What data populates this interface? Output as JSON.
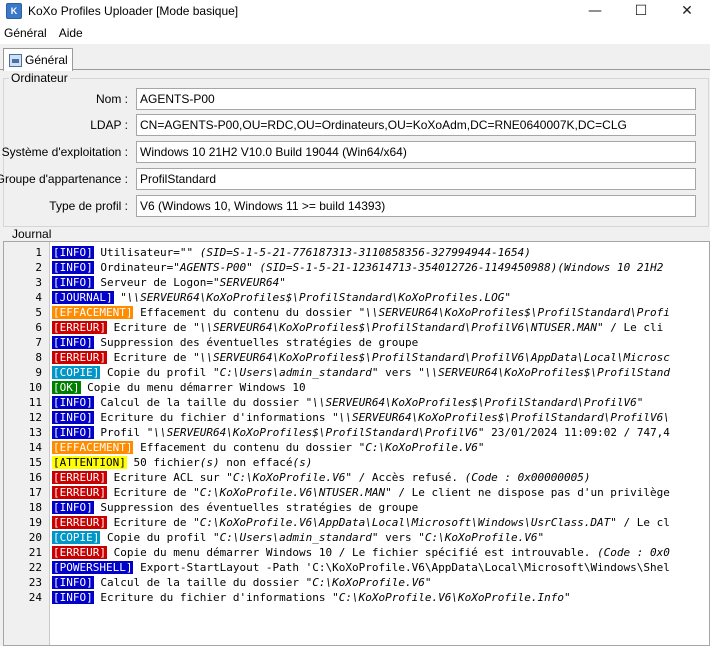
{
  "window": {
    "title": "KoXo Profiles Uploader [Mode basique]",
    "icon": "app-icon",
    "controls": {
      "minimize": "—",
      "maximize": "☐",
      "close": "✕"
    }
  },
  "menu": [
    {
      "label": "Général"
    },
    {
      "label": "Aide"
    }
  ],
  "tabs": [
    {
      "label": "Général",
      "icon": "computer-icon",
      "active": true
    }
  ],
  "ordinateur": {
    "label": "Ordinateur",
    "fields": [
      {
        "name": "nom",
        "label": "Nom :",
        "value": "AGENTS-P00"
      },
      {
        "name": "ldap",
        "label": "LDAP :",
        "value": "CN=AGENTS-P00,OU=RDC,OU=Ordinateurs,OU=KoXoAdm,DC=RNE0640007K,DC=CLG"
      },
      {
        "name": "os",
        "label": "Système d'exploitation :",
        "value": "Windows 10 21H2 V10.0 Build 19044 (Win64/x64)"
      },
      {
        "name": "groupe",
        "label": "Groupe d'appartenance :",
        "value": "ProfilStandard"
      },
      {
        "name": "type-profil",
        "label": "Type de profil :",
        "value": "V6 (Windows 10, Windows 11 >= build 14393)"
      }
    ]
  },
  "journal": {
    "label": "Journal",
    "tag_colors": {
      "INFO": {
        "bg": "#0000c8",
        "fg": "#ffffff"
      },
      "JOURNAL": {
        "bg": "#0000c8",
        "fg": "#ffffff"
      },
      "EFFACEMENT": {
        "bg": "#ff8c00",
        "fg": "#ffffff"
      },
      "ERREUR": {
        "bg": "#c80000",
        "fg": "#ffffff"
      },
      "COPIE": {
        "bg": "#0096c8",
        "fg": "#ffffff"
      },
      "OK": {
        "bg": "#008000",
        "fg": "#ffffff"
      },
      "ATTENTION": {
        "bg": "#ffff00",
        "fg": "#000000"
      },
      "POWERSHELL": {
        "bg": "#0000c8",
        "fg": "#ffffff"
      }
    },
    "lines": [
      {
        "n": "1",
        "tag": "INFO",
        "parts": [
          {
            "t": " Utilisateur="
          },
          {
            "t": "\"\"",
            "s": 1
          },
          {
            "t": "  (SID=S-1-5-21-776187313-3110858356-327994944-1654)",
            "s": 1
          }
        ]
      },
      {
        "n": "2",
        "tag": "INFO",
        "parts": [
          {
            "t": " Ordinateur="
          },
          {
            "t": "\"AGENTS-P00\"",
            "s": 1
          },
          {
            "t": "  (SID=S-1-5-21-123614713-354012726-1149450988)(Windows 10 21H2",
            "s": 1
          }
        ]
      },
      {
        "n": "3",
        "tag": "INFO",
        "parts": [
          {
            "t": " Serveur de Logon="
          },
          {
            "t": "\"SERVEUR64\"",
            "s": 1
          }
        ]
      },
      {
        "n": "4",
        "tag": "JOURNAL",
        "parts": [
          {
            "t": "  "
          },
          {
            "t": "\"\\\\SERVEUR64\\KoXoProfiles$\\ProfilStandard\\KoXoProfiles.LOG\"",
            "s": 1
          }
        ]
      },
      {
        "n": "5",
        "tag": "EFFACEMENT",
        "parts": [
          {
            "t": " Effacement du contenu du dossier "
          },
          {
            "t": "\"\\\\SERVEUR64\\KoXoProfiles$\\ProfilStandard\\Profi",
            "s": 1
          }
        ]
      },
      {
        "n": "6",
        "tag": "ERREUR",
        "parts": [
          {
            "t": " Ecriture de "
          },
          {
            "t": "\"\\\\SERVEUR64\\KoXoProfiles$\\ProfilStandard\\ProfilV6\\NTUSER.MAN\"",
            "s": 1
          },
          {
            "t": " / Le cli"
          }
        ]
      },
      {
        "n": "7",
        "tag": "INFO",
        "parts": [
          {
            "t": " Suppression des éventuelles stratégies de groupe"
          }
        ]
      },
      {
        "n": "8",
        "tag": "ERREUR",
        "parts": [
          {
            "t": " Ecriture de "
          },
          {
            "t": "\"\\\\SERVEUR64\\KoXoProfiles$\\ProfilStandard\\ProfilV6\\AppData\\Local\\Microsc",
            "s": 1
          }
        ]
      },
      {
        "n": "9",
        "tag": "COPIE",
        "parts": [
          {
            "t": " Copie du profil "
          },
          {
            "t": "\"C:\\Users\\admin_standard\"",
            "s": 1
          },
          {
            "t": " vers "
          },
          {
            "t": "\"\\\\SERVEUR64\\KoXoProfiles$\\ProfilStand",
            "s": 1
          }
        ]
      },
      {
        "n": "10",
        "tag": "OK",
        "parts": [
          {
            "t": " Copie du menu démarrer Windows 10"
          }
        ]
      },
      {
        "n": "11",
        "tag": "INFO",
        "parts": [
          {
            "t": " Calcul de la taille du dossier "
          },
          {
            "t": "\"\\\\SERVEUR64\\KoXoProfiles$\\ProfilStandard\\ProfilV6\"",
            "s": 1
          }
        ]
      },
      {
        "n": "12",
        "tag": "INFO",
        "parts": [
          {
            "t": " Ecriture du fichier d'informations "
          },
          {
            "t": "\"\\\\SERVEUR64\\KoXoProfiles$\\ProfilStandard\\ProfilV6\\",
            "s": 1
          }
        ]
      },
      {
        "n": "13",
        "tag": "INFO",
        "parts": [
          {
            "t": " Profil "
          },
          {
            "t": "\"\\\\SERVEUR64\\KoXoProfiles$\\ProfilStandard\\ProfilV6\"",
            "s": 1
          },
          {
            "t": " 23/01/2024 11:09:02 / 747,4"
          }
        ]
      },
      {
        "n": "14",
        "tag": "EFFACEMENT",
        "parts": [
          {
            "t": " Effacement du contenu du dossier "
          },
          {
            "t": "\"C:\\KoXoProfile.V6\"",
            "s": 1
          }
        ]
      },
      {
        "n": "15",
        "tag": "ATTENTION",
        "parts": [
          {
            "t": " 50 fichier"
          },
          {
            "t": "(s)",
            "s": 1
          },
          {
            "t": " non effacé"
          },
          {
            "t": "(s)",
            "s": 1
          }
        ]
      },
      {
        "n": "16",
        "tag": "ERREUR",
        "parts": [
          {
            "t": " Ecriture ACL sur "
          },
          {
            "t": "\"C:\\KoXoProfile.V6\"",
            "s": 1
          },
          {
            "t": " / Accès refusé. "
          },
          {
            "t": "(Code : 0x00000005)",
            "s": 1
          }
        ]
      },
      {
        "n": "17",
        "tag": "ERREUR",
        "parts": [
          {
            "t": " Ecriture de "
          },
          {
            "t": "\"C:\\KoXoProfile.V6\\NTUSER.MAN\"",
            "s": 1
          },
          {
            "t": " / Le client ne dispose pas d'un privilège"
          }
        ]
      },
      {
        "n": "18",
        "tag": "INFO",
        "parts": [
          {
            "t": " Suppression des éventuelles stratégies de groupe"
          }
        ]
      },
      {
        "n": "19",
        "tag": "ERREUR",
        "parts": [
          {
            "t": " Ecriture de "
          },
          {
            "t": "\"C:\\KoXoProfile.V6\\AppData\\Local\\Microsoft\\Windows\\UsrClass.DAT\"",
            "s": 1
          },
          {
            "t": " / Le cl"
          }
        ]
      },
      {
        "n": "20",
        "tag": "COPIE",
        "parts": [
          {
            "t": " Copie du profil "
          },
          {
            "t": "\"C:\\Users\\admin_standard\"",
            "s": 1
          },
          {
            "t": " vers "
          },
          {
            "t": "\"C:\\KoXoProfile.V6\"",
            "s": 1
          }
        ]
      },
      {
        "n": "21",
        "tag": "ERREUR",
        "parts": [
          {
            "t": " Copie du menu démarrer Windows 10 / Le fichier spécifié est introuvable. "
          },
          {
            "t": "(Code : 0x0",
            "s": 1
          }
        ]
      },
      {
        "n": "22",
        "tag": "POWERSHELL",
        "parts": [
          {
            "t": " Export-StartLayout -Path 'C:\\KoXoProfile.V6\\AppData\\Local\\Microsoft\\Windows\\Shel"
          }
        ]
      },
      {
        "n": "23",
        "tag": "INFO",
        "parts": [
          {
            "t": " Calcul de la taille du dossier "
          },
          {
            "t": "\"C:\\KoXoProfile.V6\"",
            "s": 1
          }
        ]
      },
      {
        "n": "24",
        "tag": "INFO",
        "parts": [
          {
            "t": " Ecriture du fichier d'informations "
          },
          {
            "t": "\"C:\\KoXoProfile.V6\\KoXoProfile.Info\"",
            "s": 1
          }
        ]
      }
    ]
  }
}
